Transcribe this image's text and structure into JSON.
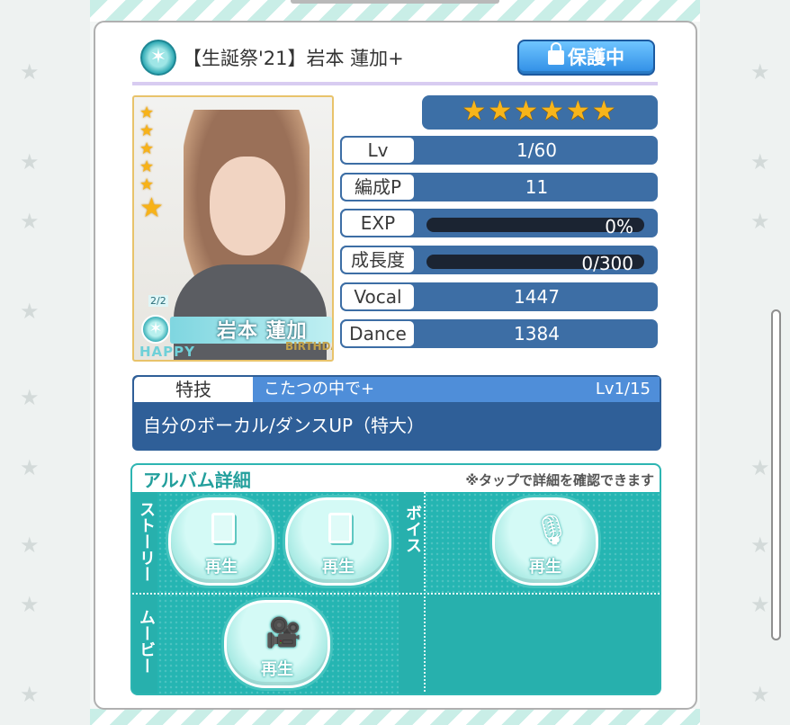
{
  "card": {
    "title": "【生誕祭'21】岩本 蓮加+",
    "protect_label": "保護中",
    "rarity_stars": "★★★★★★"
  },
  "portrait": {
    "name": "岩本 蓮加",
    "date": "2/2",
    "happy": "HAPPY",
    "birthday": "BIRTHDAY",
    "stars": [
      "★",
      "★",
      "★",
      "★",
      "★",
      "★"
    ]
  },
  "stats": {
    "lv": {
      "label": "Lv",
      "value": "1/60"
    },
    "formation": {
      "label": "編成P",
      "value": "11"
    },
    "exp": {
      "label": "EXP",
      "value": "0%",
      "progress": 0
    },
    "growth": {
      "label": "成長度",
      "value": "0/300",
      "progress": 0
    },
    "vocal": {
      "label": "Vocal",
      "value": "1447"
    },
    "dance": {
      "label": "Dance",
      "value": "1384"
    }
  },
  "skill": {
    "tab_label": "特技",
    "name": "こたつの中で+",
    "level": "Lv1/15",
    "description": "自分のボーカル/ダンスUP（特大）"
  },
  "album": {
    "title": "アルバム詳細",
    "note": "※タップで詳細を確認できます",
    "story_label": "ストーリー",
    "voice_label": "ボイス",
    "movie_label": "ムービー",
    "play_label": "再生"
  },
  "icons": {
    "header": "starburst-emblem-icon",
    "lock": "lock-icon",
    "story": "book-icon",
    "voice": "microphone-icon",
    "movie": "video-camera-icon"
  }
}
